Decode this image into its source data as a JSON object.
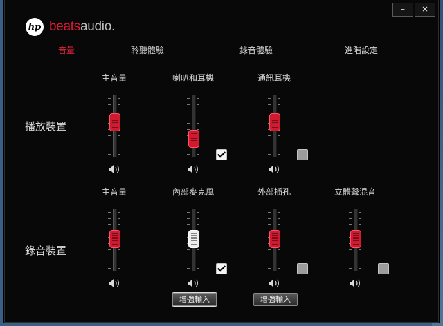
{
  "window": {
    "minimize_glyph": "–",
    "close_glyph": "×"
  },
  "logo": {
    "hp": "hp",
    "beats": "beats",
    "audio": "audio."
  },
  "tabs": [
    {
      "label": "音量",
      "active": true
    },
    {
      "label": "聆聽體驗",
      "active": false
    },
    {
      "label": "錄音體驗",
      "active": false
    },
    {
      "label": "進階設定",
      "active": false
    }
  ],
  "playback": {
    "title": "播放裝置",
    "channels": [
      {
        "label": "主音量",
        "level": 0.6,
        "thumb": "red",
        "checkbox": null
      },
      {
        "label": "喇叭和耳機",
        "level": 0.25,
        "thumb": "red",
        "checkbox": true
      },
      {
        "label": "通訊耳機",
        "level": 0.6,
        "thumb": "red",
        "checkbox": false
      }
    ]
  },
  "recording": {
    "title": "錄音裝置",
    "channels": [
      {
        "label": "主音量",
        "level": 0.55,
        "thumb": "red",
        "checkbox": null,
        "button": null
      },
      {
        "label": "內部麥克風",
        "level": 0.55,
        "thumb": "white",
        "checkbox": true,
        "button": "增強輸入"
      },
      {
        "label": "外部插孔",
        "level": 0.55,
        "thumb": "red",
        "checkbox": false,
        "button": "增強輸入"
      },
      {
        "label": "立體聲混音",
        "level": 0.55,
        "thumb": "red",
        "checkbox": false,
        "button": null
      }
    ]
  },
  "colors": {
    "accent": "#e8233e",
    "background": "#080808"
  },
  "icons": {
    "speaker": "speaker-icon",
    "minimize": "minimize-icon",
    "close": "close-icon"
  }
}
